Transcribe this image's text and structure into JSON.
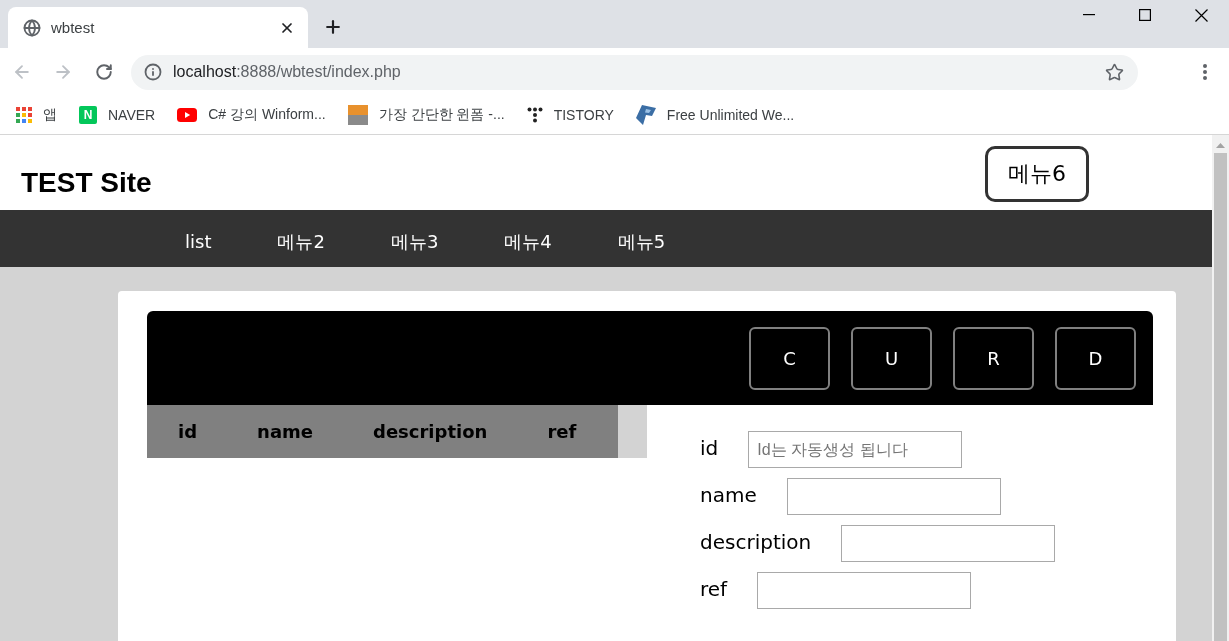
{
  "browser": {
    "tab": {
      "title": "wbtest"
    },
    "nav_buttons": [
      {
        "kind": "back",
        "disabled": true
      },
      {
        "kind": "forward",
        "disabled": true
      },
      {
        "kind": "reload",
        "disabled": false
      }
    ],
    "address": {
      "host": "localhost",
      "path": ":8888/wbtest/index.php"
    },
    "bookmarks": [
      {
        "kind": "apps",
        "label": "앱"
      },
      {
        "kind": "naver",
        "glyph": "N",
        "label": "NAVER"
      },
      {
        "kind": "youtube",
        "label": "C# 강의 Winform..."
      },
      {
        "kind": "thumbnail",
        "label": "가장 간단한 윈폼 -..."
      },
      {
        "kind": "tistory",
        "label": "TISTORY"
      },
      {
        "kind": "logo",
        "label": "Free Unlimited We..."
      }
    ]
  },
  "header": {
    "title": "TEST Site",
    "button": "메뉴6"
  },
  "nav": [
    "list",
    "메뉴2",
    "메뉴3",
    "메뉴4",
    "메뉴5"
  ],
  "toolbar": {
    "buttons": [
      "C",
      "U",
      "R",
      "D"
    ]
  },
  "table": {
    "columns": [
      "id",
      "name",
      "description",
      "ref"
    ]
  },
  "form": {
    "fields": [
      {
        "label": "id",
        "placeholder": "Id는 자동생성 됩니다"
      },
      {
        "label": "name"
      },
      {
        "label": "description"
      },
      {
        "label": "ref"
      }
    ]
  }
}
